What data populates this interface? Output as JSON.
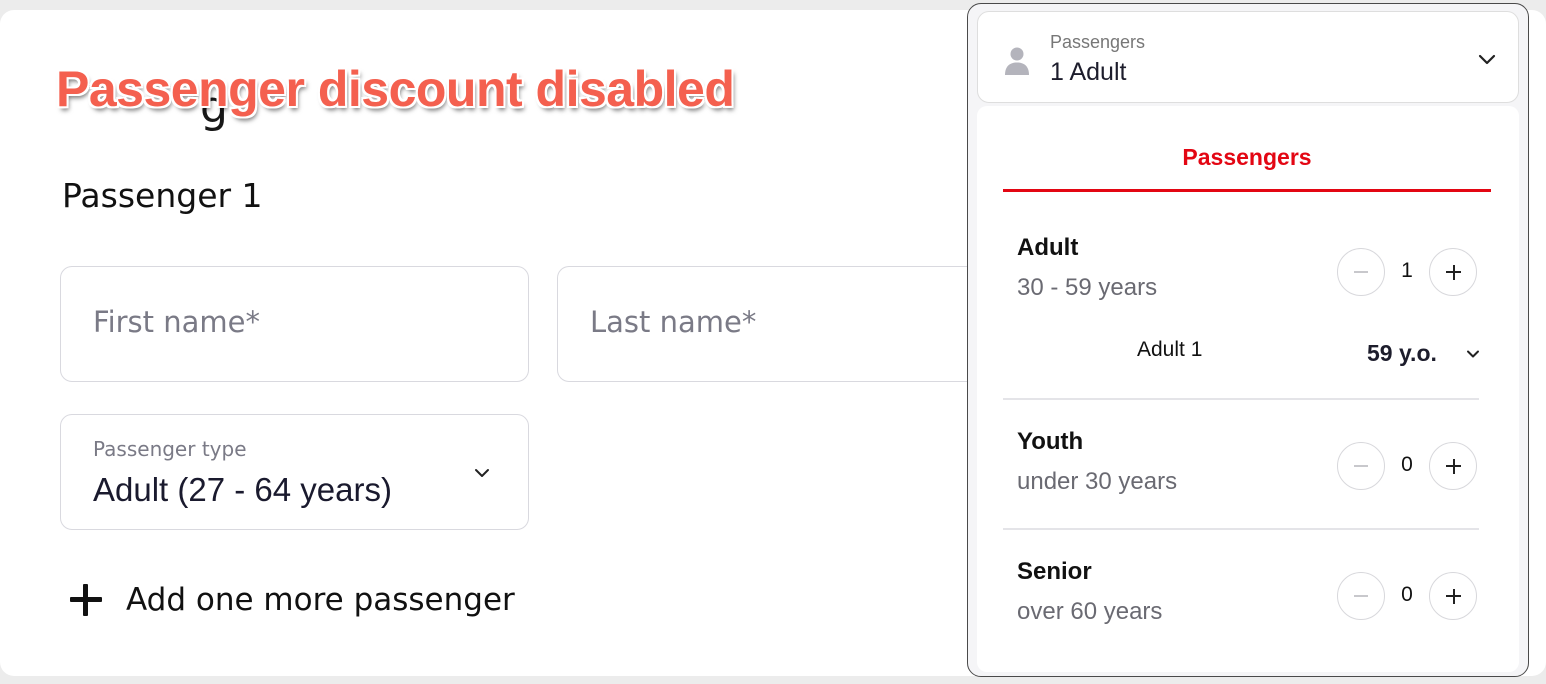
{
  "banner": {
    "text": "Passenger discount disabled"
  },
  "form": {
    "passenger_title": "Passenger 1",
    "first_name_placeholder": "First name*",
    "last_name_placeholder": "Last name*",
    "passenger_type_label": "Passenger type",
    "passenger_type_value": "Adult (27 - 64 years)",
    "add_passenger_label": "Add one more passenger"
  },
  "passenger_selector": {
    "label": "Passengers",
    "value": "1 Adult",
    "tab": "Passengers",
    "categories": [
      {
        "title": "Adult",
        "subtitle": "30 - 59 years",
        "count": "1"
      },
      {
        "title": "Youth",
        "subtitle": "under 30 years",
        "count": "0"
      },
      {
        "title": "Senior",
        "subtitle": "over 60 years",
        "count": "0"
      }
    ],
    "adult_ages": [
      {
        "name": "Adult 1",
        "age": "59 y.o."
      }
    ]
  },
  "colors": {
    "banner": "#f4604f",
    "accent_red": "#e30613"
  }
}
